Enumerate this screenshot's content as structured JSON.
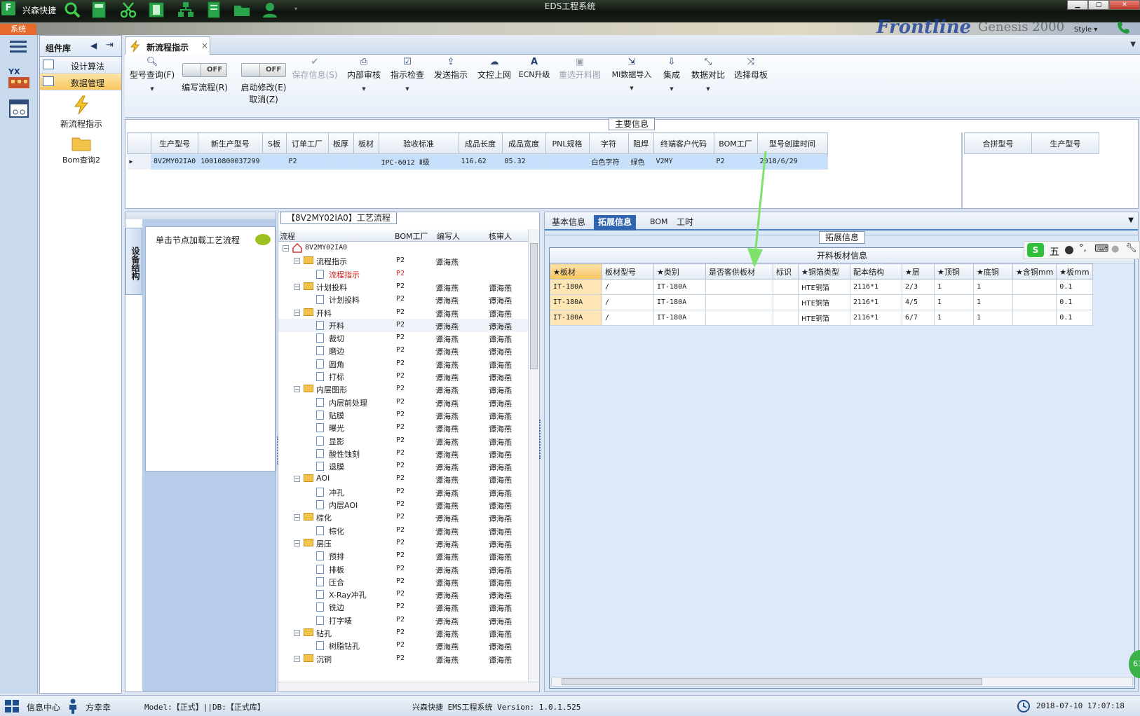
{
  "titlebar": {
    "app_name": "兴森快捷",
    "window_title": "EDS工程系统"
  },
  "menustrip": {
    "system_label": "系统",
    "brand": "Frontline",
    "brand2": "Genesis 2000",
    "style_label": "Style ▾"
  },
  "component_library": {
    "title": "组件库",
    "items": [
      {
        "label": "设计算法",
        "selected": false
      },
      {
        "label": "数据管理",
        "selected": true
      }
    ],
    "big_items": [
      {
        "label": "新流程指示",
        "icon": "lightning-icon"
      },
      {
        "label": "Bom查询2",
        "icon": "folder-icon"
      }
    ]
  },
  "doc_tab": {
    "label": "新流程指示"
  },
  "toolbar": {
    "items": [
      {
        "label": "型号查询(F)",
        "icon": "search-icon",
        "enabled": true,
        "dropdown": true
      },
      {
        "label": "编写流程(R)",
        "toggle": "OFF"
      },
      {
        "label": "启动修改(E)",
        "label2": "取消(Z)",
        "toggle": "OFF"
      },
      {
        "label": "保存信息(S)",
        "icon": "check-icon",
        "enabled": false
      },
      {
        "label": "内部审核",
        "icon": "printer-icon",
        "enabled": true,
        "dropdown": true
      },
      {
        "label": "指示检查",
        "icon": "checkbox-icon",
        "enabled": true,
        "dropdown": true
      },
      {
        "label": "发送指示",
        "icon": "upload-icon",
        "enabled": true
      },
      {
        "label": "文控上网",
        "icon": "cloud-icon",
        "enabled": true
      },
      {
        "label": "ECN升级",
        "icon": "a-icon",
        "enabled": true
      },
      {
        "label": "重选开料图",
        "icon": "image-icon",
        "enabled": false
      },
      {
        "label": "MI数据导入",
        "icon": "import-icon",
        "enabled": true,
        "dropdown": true
      },
      {
        "label": "集成",
        "icon": "download-icon",
        "enabled": true,
        "dropdown": true
      },
      {
        "label": "数据对比",
        "icon": "compress-icon",
        "enabled": true,
        "dropdown": true
      },
      {
        "label": "选择母板",
        "icon": "shuffle-icon",
        "enabled": true
      }
    ]
  },
  "main_info": {
    "title": "主要信息",
    "columns": [
      "生产型号",
      "新生产型号",
      "S板",
      "订单工厂",
      "板厚",
      "板材",
      "验收标准",
      "成品长度",
      "成品宽度",
      "PNL规格",
      "字符",
      "阻焊",
      "终端客户代码",
      "BOM工厂",
      "型号创建时间"
    ],
    "rows": [
      [
        "8V2MY02IA0",
        "10010800037299",
        "",
        "P2",
        "",
        "",
        "IPC-6012 Ⅱ级",
        "116.62",
        "85.32",
        "",
        "白色字符",
        "绿色",
        "V2MY",
        "P2",
        "2018/6/29"
      ]
    ],
    "side_columns": [
      "合拼型号",
      "生产型号"
    ]
  },
  "left_pane": {
    "vertical_tab": "设备结构",
    "card_text": "单击节点加载工艺流程"
  },
  "flow_pane": {
    "title": "【8V2MY02IA0】工艺流程",
    "columns": [
      "流程",
      "BOM工厂",
      "编写人",
      "核审人"
    ],
    "root": "8V2MY02IA0",
    "rows": [
      {
        "name": "流程指示",
        "level": 1,
        "type": "folder",
        "bom": "P2",
        "writer": "谭海燕",
        "reviewer": ""
      },
      {
        "name": "流程指示",
        "level": 2,
        "type": "file",
        "bom": "P2",
        "writer": "",
        "reviewer": "",
        "red": true
      },
      {
        "name": "计划投料",
        "level": 1,
        "type": "folder",
        "bom": "P2",
        "writer": "谭海燕",
        "reviewer": "谭海燕"
      },
      {
        "name": "计划投料",
        "level": 2,
        "type": "file",
        "bom": "P2",
        "writer": "谭海燕",
        "reviewer": "谭海燕"
      },
      {
        "name": "开料",
        "level": 1,
        "type": "folder",
        "bom": "P2",
        "writer": "谭海燕",
        "reviewer": "谭海燕"
      },
      {
        "name": "开料",
        "level": 2,
        "type": "file",
        "bom": "P2",
        "writer": "谭海燕",
        "reviewer": "谭海燕",
        "hl": true
      },
      {
        "name": "裁切",
        "level": 2,
        "type": "file",
        "bom": "P2",
        "writer": "谭海燕",
        "reviewer": "谭海燕"
      },
      {
        "name": "磨边",
        "level": 2,
        "type": "file",
        "bom": "P2",
        "writer": "谭海燕",
        "reviewer": "谭海燕"
      },
      {
        "name": "圆角",
        "level": 2,
        "type": "file",
        "bom": "P2",
        "writer": "谭海燕",
        "reviewer": "谭海燕"
      },
      {
        "name": "打标",
        "level": 2,
        "type": "file",
        "bom": "P2",
        "writer": "谭海燕",
        "reviewer": "谭海燕"
      },
      {
        "name": "内层图形",
        "level": 1,
        "type": "folder",
        "bom": "P2",
        "writer": "谭海燕",
        "reviewer": "谭海燕"
      },
      {
        "name": "内层前处理",
        "level": 2,
        "type": "file",
        "bom": "P2",
        "writer": "谭海燕",
        "reviewer": "谭海燕"
      },
      {
        "name": "贴膜",
        "level": 2,
        "type": "file",
        "bom": "P2",
        "writer": "谭海燕",
        "reviewer": "谭海燕"
      },
      {
        "name": "曝光",
        "level": 2,
        "type": "file",
        "bom": "P2",
        "writer": "谭海燕",
        "reviewer": "谭海燕"
      },
      {
        "name": "显影",
        "level": 2,
        "type": "file",
        "bom": "P2",
        "writer": "谭海燕",
        "reviewer": "谭海燕"
      },
      {
        "name": "酸性蚀刻",
        "level": 2,
        "type": "file",
        "bom": "P2",
        "writer": "谭海燕",
        "reviewer": "谭海燕"
      },
      {
        "name": "退膜",
        "level": 2,
        "type": "file",
        "bom": "P2",
        "writer": "谭海燕",
        "reviewer": "谭海燕"
      },
      {
        "name": "AOI",
        "level": 1,
        "type": "folder",
        "bom": "P2",
        "writer": "谭海燕",
        "reviewer": "谭海燕"
      },
      {
        "name": "冲孔",
        "level": 2,
        "type": "file",
        "bom": "P2",
        "writer": "谭海燕",
        "reviewer": "谭海燕"
      },
      {
        "name": "内层AOI",
        "level": 2,
        "type": "file",
        "bom": "P2",
        "writer": "谭海燕",
        "reviewer": "谭海燕"
      },
      {
        "name": "棕化",
        "level": 1,
        "type": "folder",
        "bom": "P2",
        "writer": "谭海燕",
        "reviewer": "谭海燕"
      },
      {
        "name": "棕化",
        "level": 2,
        "type": "file",
        "bom": "P2",
        "writer": "谭海燕",
        "reviewer": "谭海燕"
      },
      {
        "name": "层压",
        "level": 1,
        "type": "folder",
        "bom": "P2",
        "writer": "谭海燕",
        "reviewer": "谭海燕"
      },
      {
        "name": "预排",
        "level": 2,
        "type": "file",
        "bom": "P2",
        "writer": "谭海燕",
        "reviewer": "谭海燕"
      },
      {
        "name": "排板",
        "level": 2,
        "type": "file",
        "bom": "P2",
        "writer": "谭海燕",
        "reviewer": "谭海燕"
      },
      {
        "name": "压合",
        "level": 2,
        "type": "file",
        "bom": "P2",
        "writer": "谭海燕",
        "reviewer": "谭海燕"
      },
      {
        "name": "X-Ray冲孔",
        "level": 2,
        "type": "file",
        "bom": "P2",
        "writer": "谭海燕",
        "reviewer": "谭海燕"
      },
      {
        "name": "铣边",
        "level": 2,
        "type": "file",
        "bom": "P2",
        "writer": "谭海燕",
        "reviewer": "谭海燕"
      },
      {
        "name": "打字唛",
        "level": 2,
        "type": "file",
        "bom": "P2",
        "writer": "谭海燕",
        "reviewer": "谭海燕"
      },
      {
        "name": "钻孔",
        "level": 1,
        "type": "folder",
        "bom": "P2",
        "writer": "谭海燕",
        "reviewer": "谭海燕"
      },
      {
        "name": "树脂钻孔",
        "level": 2,
        "type": "file",
        "bom": "P2",
        "writer": "谭海燕",
        "reviewer": "谭海燕"
      },
      {
        "name": "沉铜",
        "level": 1,
        "type": "folder",
        "bom": "P2",
        "writer": "谭海燕",
        "reviewer": "谭海燕"
      }
    ]
  },
  "right_pane": {
    "tabs": [
      {
        "label": "基本信息",
        "active": false
      },
      {
        "label": "拓展信息",
        "active": true
      },
      {
        "label": "BOM",
        "active": false
      },
      {
        "label": "工时",
        "active": false
      }
    ],
    "section_title": "拓展信息",
    "grid_caption": "开料板材信息",
    "columns": [
      "★板材",
      "板材型号",
      "★类别",
      "是否客供板材",
      "标识",
      "★铜箔类型",
      "配本结构",
      "★层",
      "★顶铜",
      "★底铜",
      "★含铜mm",
      "★板mm"
    ],
    "rows": [
      [
        "IT-180A",
        "/",
        "IT-180A",
        "",
        "",
        "HTE铜箔",
        "2116*1",
        "2/3",
        "1",
        "1",
        "",
        "0.1"
      ],
      [
        "IT-180A",
        "/",
        "IT-180A",
        "",
        "",
        "HTE铜箔",
        "2116*1",
        "4/5",
        "1",
        "1",
        "",
        "0.1"
      ],
      [
        "IT-180A",
        "/",
        "IT-180A",
        "",
        "",
        "HTE铜箔",
        "2116*1",
        "6/7",
        "1",
        "1",
        "",
        "0.1"
      ]
    ]
  },
  "ime": {
    "label": "五"
  },
  "statusbar": {
    "info_center": "信息中心",
    "user": "方幸幸",
    "model": "Model:【正式】||DB:【正式库】",
    "version": "兴森快捷 EMS工程系统 Version: 1.0.1.525",
    "datetime": "2018-07-10 17:07:18"
  },
  "colors": {
    "accent": "#2f64b0",
    "selected_row": "#c6e0fb",
    "highlight_orange": "#f7c760",
    "arrow_green": "#7ee26a",
    "red_text": "#d21f1f"
  }
}
